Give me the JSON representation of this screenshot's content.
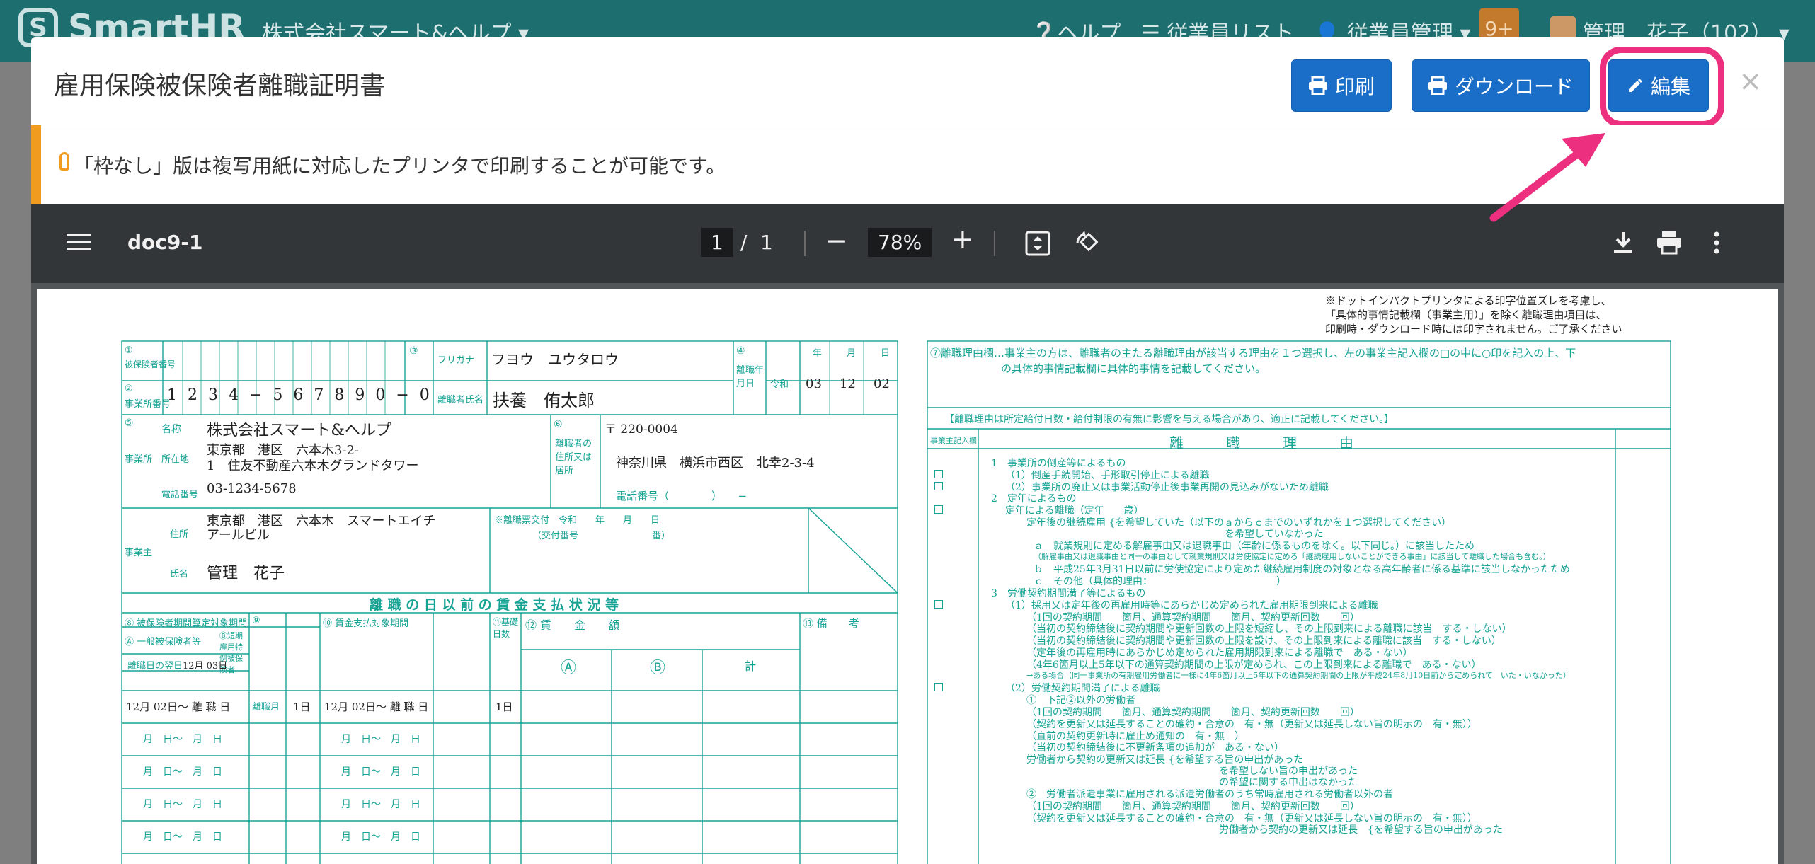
{
  "appbar": {
    "logo": "SmartHR",
    "company": "株式会社スマート&ヘルプ ▾",
    "help": "❔ヘルプ",
    "employee_list": "☰ 従業員リスト",
    "employee_mgmt": "👤 従業員管理 ▾",
    "badge": "9+",
    "user": "管理　花子（102） ▾"
  },
  "modal": {
    "title": "雇用保険被保険者離職証明書",
    "print_label": "印刷",
    "download_label": "ダウンロード",
    "edit_label": "編集",
    "close": "×"
  },
  "notice": {
    "text": "「枠なし」版は複写用紙に対応したプリンタで印刷することが可能です。"
  },
  "viewer": {
    "filename": "doc9-1",
    "page_current": "1",
    "page_sep": "/",
    "page_total": "1",
    "zoom": "78%",
    "minus": "−",
    "plus": "+"
  },
  "doc": {
    "top_note": [
      "※ドットインパクトプリンタによる印字位置ズレを考慮し、",
      "「具体的事情記載欄（事業主用）」を除く離職理由項目は、",
      "印刷時・ダウンロード時には印字されません。ご了承ください"
    ],
    "left": {
      "insured_no_label": "被保険者番号",
      "office_no_label": "事業所番号",
      "office_no_digits": "1 2 3 4 − 5 6 7 8 9 0 − 0",
      "furigana_label": "フリガナ",
      "furigana": "フヨウ　ユウタロウ",
      "name_label": "離職者氏名",
      "name": "扶養　侑太郎",
      "leave_date_label": "離職年月日",
      "era": "令和",
      "year_h": "年",
      "month_h": "月",
      "day_h": "日",
      "year": "03",
      "month": "12",
      "day": "02",
      "office_label": "事業所",
      "company_name_label": "名称",
      "company_name": "株式会社スマート&ヘルプ",
      "address_label": "所在地",
      "address1": "東京都　港区　六本木3-2-",
      "address2": "1　住友不動産六本木グランドタワー",
      "tel_label": "電話番号",
      "tel": "03-1234-5678",
      "leaver_label": "離職者の住所又は居所",
      "zip": "〒 220-0004",
      "leaver_address": "神奈川県　横浜市西区　北幸2-3-4",
      "leaver_tel": "電話番号（　　　　）　　−",
      "employer_label": "事業主",
      "employer_addr_label": "住所",
      "employer_addr1": "東京都　港区　六本木　スマートエイチ",
      "employer_addr2": "アールビル",
      "employer_name_label": "氏名",
      "employer_name": "管理　花子",
      "issue_label": "※離職票交付　令和　　年　　月　　日",
      "issue_no": "（交付番号　　　　　　　　番）",
      "wage_title": "離 職 の 日 以 前 の 賃 金 支 払 状 況 等",
      "col8": "⑧ 被保険者期間算定対象期間",
      "col8a": "Ⓐ 一般被保険者等",
      "col8b": "Ⓑ短期雇用特例被保険者",
      "col9": "⑨",
      "col10": "⑩ 賃金支払対象期間",
      "col11": "⑪基礎日数",
      "col12": "⑫ 賃　　金　　額",
      "col12a": "Ⓐ",
      "col12b": "Ⓑ",
      "col12c": "計",
      "col13": "⑬ 備　　考",
      "nextday_label": "離職日の翌日",
      "nextday": "12月 03日",
      "row1_a": "12月 02日〜 離 職 日",
      "row1_b": "離職月",
      "row1_d": "1日",
      "row1_p": "12月 02日〜 離 職 日",
      "row1_e": "1日",
      "row_blank": "月　日〜　月　日"
    },
    "right": {
      "reason_title": "⑦離職理由欄…事業主の方は、離職者の主たる離職理由が該当する理由を１つ選択し、左の事業主記入欄の□の中に○印を記入の上、下",
      "reason_title2": "の具体的事情記載欄に具体的事情を記載してください。",
      "reason_note": "【離職理由は所定給付日数・給付制限の有無に影響を与える場合があり、適正に記載してください。】",
      "col_employer": "事業主記入欄",
      "col_reason": "離　　　職　　　理　　　由",
      "lines": [
        "1　事業所の倒産等によるもの",
        "（1）倒産手続開始、手形取引停止による離職",
        "（2）事業所の廃止又は事業活動停止後事業再開の見込みがないため離職",
        "2　定年によるもの",
        "定年による離職（定年　　歳）",
        "定年後の継続雇用 {を希望していた（以下のａからｃまでのいずれかを１つ選択してください）",
        "を希望していなかった",
        "ａ　就業規則に定める解雇事由又は退職事由（年齢に係るものを除く。以下同じ。）に該当したため",
        "（解雇事由又は退職事由と同一の事由として就業規則又は労使協定に定める「継続雇用しないことができる事由」に該当して離職した場合も含む。）",
        "ｂ　平成25年3月31日以前に労使協定により定めた継続雇用制度の対象となる高年齢者に係る基準に該当しなかったため",
        "ｃ　その他（具体的理由：　　　　　　　　　　　　　）",
        "3　労働契約期間満了等によるもの",
        "（1）採用又は定年後の再雇用時等にあらかじめ定められた雇用期限到来による離職",
        "（1回の契約期間　　箇月、通算契約期間　　箇月、契約更新回数　　回）",
        "（当初の契約締結後に契約期間や更新回数の上限を短縮し、その上限到来による離職に該当　する・しない）",
        "（当初の契約締結後に契約期間や更新回数の上限を設け、その上限到来による離職に該当　する・しない）",
        "（定年後の再雇用時にあらかじめ定められた雇用期限到来による離職で　ある・ない）",
        "（4年6箇月以上5年以下の通算契約期間の上限が定められ、この上限到来による離職で　ある・ない）",
        "→ある場合（同一事業所の有期雇用労働者に一様に4年6箇月以上5年以下の通算契約期間の上限が平成24年8月10日前から定められて　いた・いなかった）",
        "（2）労働契約期間満了による離職",
        "①　下記②以外の労働者",
        "（1回の契約期間　　箇月、通算契約期間　　箇月、契約更新回数　　回）",
        "（契約を更新又は延長することの確約・合意の　有・無（更新又は延長しない旨の明示の　有・無））",
        "（直前の契約更新時に雇止め通知の　有・無　）",
        "（当初の契約締結後に不更新条項の追加が　ある・ない）",
        "労働者から契約の更新又は延長 {を希望する旨の申出があった",
        "を希望しない旨の申出があった",
        "の希望に関する申出はなかった",
        "②　労働者派遣事業に雇用される派遣労働者のうち常時雇用される労働者以外の者",
        "（1回の契約期間　　箇月、通算契約期間　　箇月、契約更新回数　　回）",
        "（契約を更新又は延長することの確約・合意の　有・無（更新又は延長しない旨の明示の　有・無））",
        "労働者から契約の更新又は延長　{を希望する旨の申出があった"
      ]
    }
  },
  "colors": {
    "brand": "#1d6e6f",
    "button": "#1a6ec7",
    "highlight": "#ec2f7e",
    "form": "#16a394",
    "notice": "#f29b21"
  }
}
